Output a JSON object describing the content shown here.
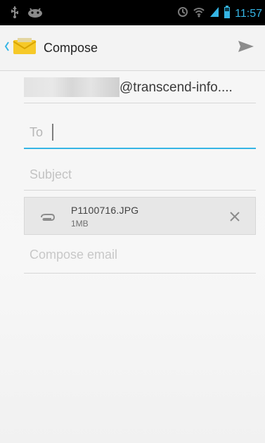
{
  "status_bar": {
    "time": "11:57",
    "icons": [
      "usb-icon",
      "android-icon",
      "alarm-icon",
      "wifi-icon",
      "signal-icon",
      "battery-icon"
    ]
  },
  "action_bar": {
    "title": "Compose",
    "icons": [
      "chevron-left-icon",
      "email-app-icon",
      "send-icon"
    ]
  },
  "form": {
    "from_domain": "@transcend-info....",
    "to_label": "To",
    "subject_placeholder": "Subject",
    "attachment": {
      "name": "P1100716.JPG",
      "size": "1MB"
    },
    "body_placeholder": "Compose email"
  },
  "colors": {
    "accent": "#35b5e5",
    "background": "#f5f5f5"
  }
}
